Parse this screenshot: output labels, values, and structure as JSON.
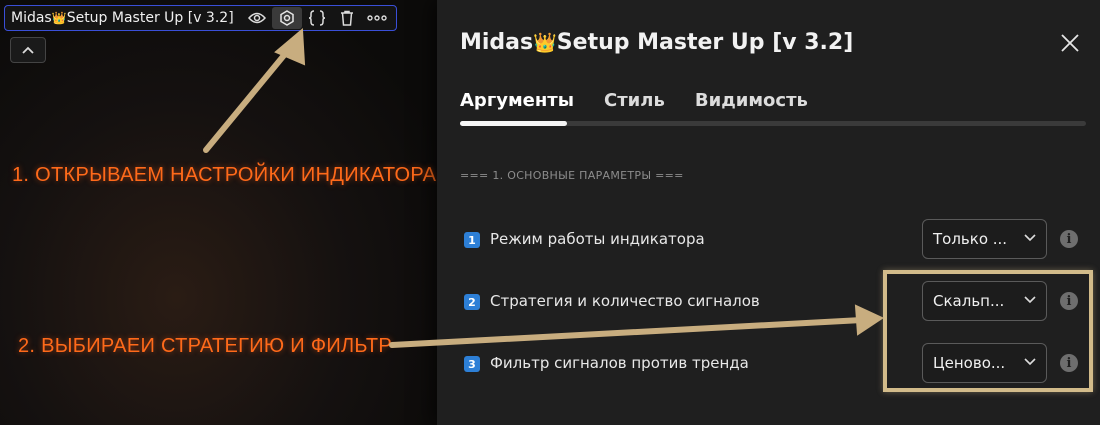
{
  "legend": {
    "title_prefix": "Midas",
    "crown_icon": "👑",
    "title_suffix": "Setup Master Up [v 3.2]"
  },
  "annotations": {
    "step1": "1. ОТКРЫВАЕМ НАСТРОЙКИ ИНДИКАТОРА",
    "step2": "2. ВЫБИРАЕИ СТРАТЕГИЮ И ФИЛЬТР"
  },
  "colors": {
    "annotation_text": "#ff6a1a",
    "arrow": "#c8ad7f",
    "highlight": "#d2bb8a",
    "badge": "#2d7fd6",
    "legend_border": "#3a4fd8"
  },
  "dialog": {
    "title_prefix": "Midas",
    "crown_icon": "👑",
    "title_suffix": "Setup Master Up [v 3.2]",
    "tabs": [
      {
        "label": "Аргументы",
        "active": true
      },
      {
        "label": "Стиль",
        "active": false
      },
      {
        "label": "Видимость",
        "active": false
      }
    ],
    "section_header": "=== 1. ОСНОВНЫЕ ПАРАМЕТРЫ ===",
    "rows": [
      {
        "badge": "1",
        "label": "Режим работы индикатора",
        "value": "Только ..."
      },
      {
        "badge": "2",
        "label": "Стратегия и количество сигналов",
        "value": "Скальп..."
      },
      {
        "badge": "3",
        "label": "Фильтр сигналов против тренда",
        "value": "Ценово..."
      }
    ]
  }
}
